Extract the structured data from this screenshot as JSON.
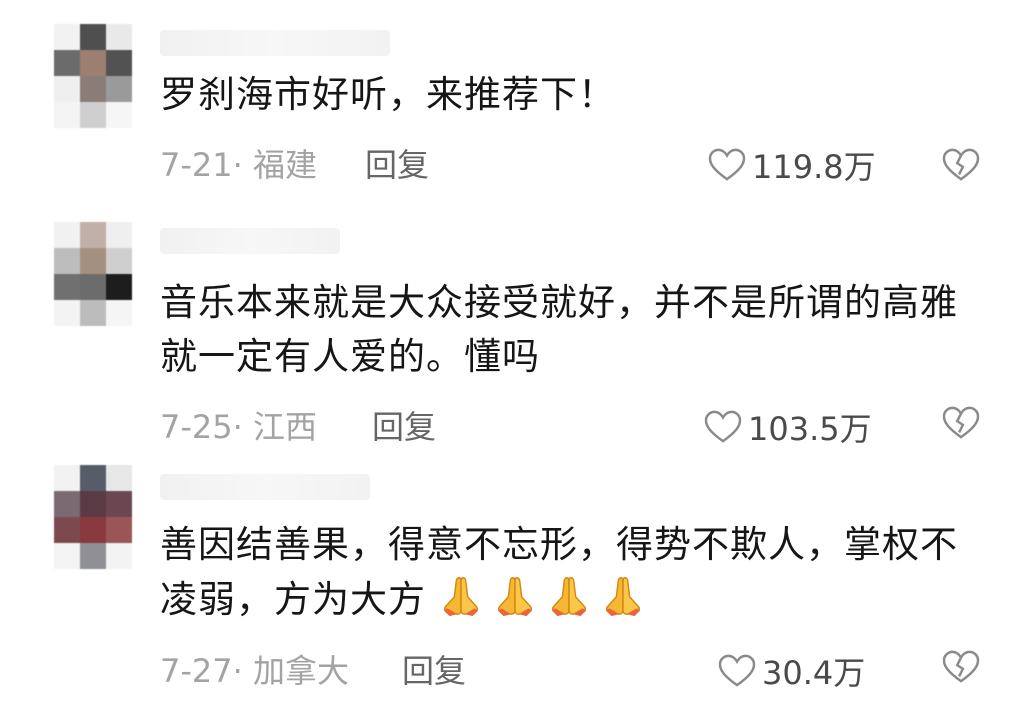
{
  "comments": [
    {
      "text": "罗刹海市好听，来推荐下！",
      "meta": "7-21· 福建",
      "reply": "回复",
      "likes": "119.8万",
      "avatar_colors": [
        "#f2f2f2",
        "#4f4f4f",
        "#e9e9e9",
        "#6b6b6b",
        "#9d7f72",
        "#525252",
        "#efefef",
        "#8a7c76",
        "#9a9a9a",
        "#f4f4f4",
        "#cfcfcf",
        "#f6f6f6"
      ]
    },
    {
      "text": "音乐本来就是大众接受就好，并不是所谓的高雅就一定有人爱的。懂吗",
      "meta": "7-25· 江西",
      "reply": "回复",
      "likes": "103.5万",
      "avatar_colors": [
        "#f1f1f1",
        "#c1b0a8",
        "#efefef",
        "#bdbdbd",
        "#a5907f",
        "#cfcfcf",
        "#707070",
        "#6c6c6c",
        "#1d1d1d",
        "#f3f3f3",
        "#bcbcbc",
        "#f5f5f5"
      ]
    },
    {
      "text": "善因结善果，得意不忘形，得势不欺人，掌权不凌弱，方为大方",
      "emoji_count": 4,
      "meta": "7-27· 加拿大",
      "reply": "回复",
      "likes": "30.4万",
      "avatar_colors": [
        "#f2f2f2",
        "#575d68",
        "#e7e7e7",
        "#7a6a72",
        "#5a3a44",
        "#6b4851",
        "#7c4a4e",
        "#8a3a3c",
        "#9a5657",
        "#f4f4f4",
        "#8e9096",
        "#f3f3f3"
      ]
    }
  ]
}
